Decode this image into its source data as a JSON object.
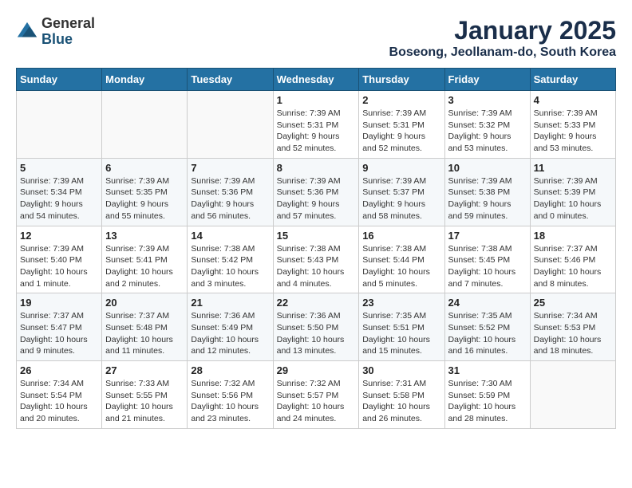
{
  "logo": {
    "general": "General",
    "blue": "Blue"
  },
  "header": {
    "title": "January 2025",
    "subtitle": "Boseong, Jeollanam-do, South Korea"
  },
  "days_of_week": [
    "Sunday",
    "Monday",
    "Tuesday",
    "Wednesday",
    "Thursday",
    "Friday",
    "Saturday"
  ],
  "weeks": [
    [
      {
        "day": "",
        "info": ""
      },
      {
        "day": "",
        "info": ""
      },
      {
        "day": "",
        "info": ""
      },
      {
        "day": "1",
        "info": "Sunrise: 7:39 AM\nSunset: 5:31 PM\nDaylight: 9 hours and 52 minutes."
      },
      {
        "day": "2",
        "info": "Sunrise: 7:39 AM\nSunset: 5:31 PM\nDaylight: 9 hours and 52 minutes."
      },
      {
        "day": "3",
        "info": "Sunrise: 7:39 AM\nSunset: 5:32 PM\nDaylight: 9 hours and 53 minutes."
      },
      {
        "day": "4",
        "info": "Sunrise: 7:39 AM\nSunset: 5:33 PM\nDaylight: 9 hours and 53 minutes."
      }
    ],
    [
      {
        "day": "5",
        "info": "Sunrise: 7:39 AM\nSunset: 5:34 PM\nDaylight: 9 hours and 54 minutes."
      },
      {
        "day": "6",
        "info": "Sunrise: 7:39 AM\nSunset: 5:35 PM\nDaylight: 9 hours and 55 minutes."
      },
      {
        "day": "7",
        "info": "Sunrise: 7:39 AM\nSunset: 5:36 PM\nDaylight: 9 hours and 56 minutes."
      },
      {
        "day": "8",
        "info": "Sunrise: 7:39 AM\nSunset: 5:36 PM\nDaylight: 9 hours and 57 minutes."
      },
      {
        "day": "9",
        "info": "Sunrise: 7:39 AM\nSunset: 5:37 PM\nDaylight: 9 hours and 58 minutes."
      },
      {
        "day": "10",
        "info": "Sunrise: 7:39 AM\nSunset: 5:38 PM\nDaylight: 9 hours and 59 minutes."
      },
      {
        "day": "11",
        "info": "Sunrise: 7:39 AM\nSunset: 5:39 PM\nDaylight: 10 hours and 0 minutes."
      }
    ],
    [
      {
        "day": "12",
        "info": "Sunrise: 7:39 AM\nSunset: 5:40 PM\nDaylight: 10 hours and 1 minute."
      },
      {
        "day": "13",
        "info": "Sunrise: 7:39 AM\nSunset: 5:41 PM\nDaylight: 10 hours and 2 minutes."
      },
      {
        "day": "14",
        "info": "Sunrise: 7:38 AM\nSunset: 5:42 PM\nDaylight: 10 hours and 3 minutes."
      },
      {
        "day": "15",
        "info": "Sunrise: 7:38 AM\nSunset: 5:43 PM\nDaylight: 10 hours and 4 minutes."
      },
      {
        "day": "16",
        "info": "Sunrise: 7:38 AM\nSunset: 5:44 PM\nDaylight: 10 hours and 5 minutes."
      },
      {
        "day": "17",
        "info": "Sunrise: 7:38 AM\nSunset: 5:45 PM\nDaylight: 10 hours and 7 minutes."
      },
      {
        "day": "18",
        "info": "Sunrise: 7:37 AM\nSunset: 5:46 PM\nDaylight: 10 hours and 8 minutes."
      }
    ],
    [
      {
        "day": "19",
        "info": "Sunrise: 7:37 AM\nSunset: 5:47 PM\nDaylight: 10 hours and 9 minutes."
      },
      {
        "day": "20",
        "info": "Sunrise: 7:37 AM\nSunset: 5:48 PM\nDaylight: 10 hours and 11 minutes."
      },
      {
        "day": "21",
        "info": "Sunrise: 7:36 AM\nSunset: 5:49 PM\nDaylight: 10 hours and 12 minutes."
      },
      {
        "day": "22",
        "info": "Sunrise: 7:36 AM\nSunset: 5:50 PM\nDaylight: 10 hours and 13 minutes."
      },
      {
        "day": "23",
        "info": "Sunrise: 7:35 AM\nSunset: 5:51 PM\nDaylight: 10 hours and 15 minutes."
      },
      {
        "day": "24",
        "info": "Sunrise: 7:35 AM\nSunset: 5:52 PM\nDaylight: 10 hours and 16 minutes."
      },
      {
        "day": "25",
        "info": "Sunrise: 7:34 AM\nSunset: 5:53 PM\nDaylight: 10 hours and 18 minutes."
      }
    ],
    [
      {
        "day": "26",
        "info": "Sunrise: 7:34 AM\nSunset: 5:54 PM\nDaylight: 10 hours and 20 minutes."
      },
      {
        "day": "27",
        "info": "Sunrise: 7:33 AM\nSunset: 5:55 PM\nDaylight: 10 hours and 21 minutes."
      },
      {
        "day": "28",
        "info": "Sunrise: 7:32 AM\nSunset: 5:56 PM\nDaylight: 10 hours and 23 minutes."
      },
      {
        "day": "29",
        "info": "Sunrise: 7:32 AM\nSunset: 5:57 PM\nDaylight: 10 hours and 24 minutes."
      },
      {
        "day": "30",
        "info": "Sunrise: 7:31 AM\nSunset: 5:58 PM\nDaylight: 10 hours and 26 minutes."
      },
      {
        "day": "31",
        "info": "Sunrise: 7:30 AM\nSunset: 5:59 PM\nDaylight: 10 hours and 28 minutes."
      },
      {
        "day": "",
        "info": ""
      }
    ]
  ]
}
